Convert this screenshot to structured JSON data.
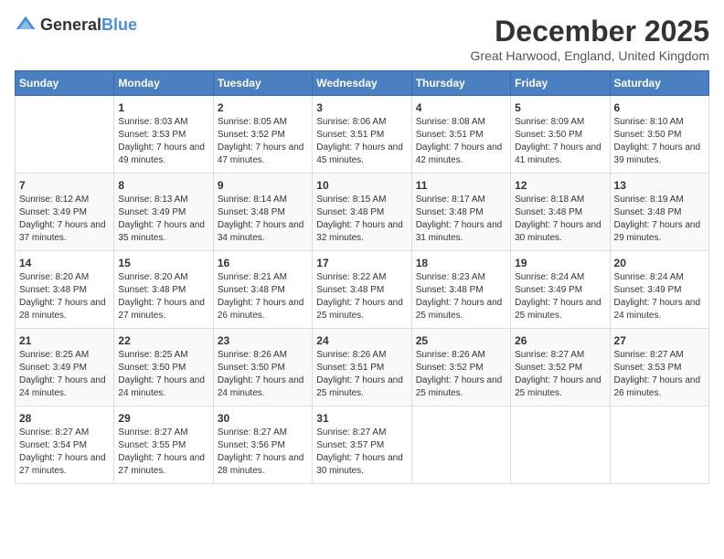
{
  "header": {
    "logo_general": "General",
    "logo_blue": "Blue",
    "month_year": "December 2025",
    "location": "Great Harwood, England, United Kingdom"
  },
  "days_of_week": [
    "Sunday",
    "Monday",
    "Tuesday",
    "Wednesday",
    "Thursday",
    "Friday",
    "Saturday"
  ],
  "weeks": [
    [
      {
        "date": "",
        "sunrise": "",
        "sunset": "",
        "daylight": ""
      },
      {
        "date": "1",
        "sunrise": "Sunrise: 8:03 AM",
        "sunset": "Sunset: 3:53 PM",
        "daylight": "Daylight: 7 hours and 49 minutes."
      },
      {
        "date": "2",
        "sunrise": "Sunrise: 8:05 AM",
        "sunset": "Sunset: 3:52 PM",
        "daylight": "Daylight: 7 hours and 47 minutes."
      },
      {
        "date": "3",
        "sunrise": "Sunrise: 8:06 AM",
        "sunset": "Sunset: 3:51 PM",
        "daylight": "Daylight: 7 hours and 45 minutes."
      },
      {
        "date": "4",
        "sunrise": "Sunrise: 8:08 AM",
        "sunset": "Sunset: 3:51 PM",
        "daylight": "Daylight: 7 hours and 42 minutes."
      },
      {
        "date": "5",
        "sunrise": "Sunrise: 8:09 AM",
        "sunset": "Sunset: 3:50 PM",
        "daylight": "Daylight: 7 hours and 41 minutes."
      },
      {
        "date": "6",
        "sunrise": "Sunrise: 8:10 AM",
        "sunset": "Sunset: 3:50 PM",
        "daylight": "Daylight: 7 hours and 39 minutes."
      }
    ],
    [
      {
        "date": "7",
        "sunrise": "Sunrise: 8:12 AM",
        "sunset": "Sunset: 3:49 PM",
        "daylight": "Daylight: 7 hours and 37 minutes."
      },
      {
        "date": "8",
        "sunrise": "Sunrise: 8:13 AM",
        "sunset": "Sunset: 3:49 PM",
        "daylight": "Daylight: 7 hours and 35 minutes."
      },
      {
        "date": "9",
        "sunrise": "Sunrise: 8:14 AM",
        "sunset": "Sunset: 3:48 PM",
        "daylight": "Daylight: 7 hours and 34 minutes."
      },
      {
        "date": "10",
        "sunrise": "Sunrise: 8:15 AM",
        "sunset": "Sunset: 3:48 PM",
        "daylight": "Daylight: 7 hours and 32 minutes."
      },
      {
        "date": "11",
        "sunrise": "Sunrise: 8:17 AM",
        "sunset": "Sunset: 3:48 PM",
        "daylight": "Daylight: 7 hours and 31 minutes."
      },
      {
        "date": "12",
        "sunrise": "Sunrise: 8:18 AM",
        "sunset": "Sunset: 3:48 PM",
        "daylight": "Daylight: 7 hours and 30 minutes."
      },
      {
        "date": "13",
        "sunrise": "Sunrise: 8:19 AM",
        "sunset": "Sunset: 3:48 PM",
        "daylight": "Daylight: 7 hours and 29 minutes."
      }
    ],
    [
      {
        "date": "14",
        "sunrise": "Sunrise: 8:20 AM",
        "sunset": "Sunset: 3:48 PM",
        "daylight": "Daylight: 7 hours and 28 minutes."
      },
      {
        "date": "15",
        "sunrise": "Sunrise: 8:20 AM",
        "sunset": "Sunset: 3:48 PM",
        "daylight": "Daylight: 7 hours and 27 minutes."
      },
      {
        "date": "16",
        "sunrise": "Sunrise: 8:21 AM",
        "sunset": "Sunset: 3:48 PM",
        "daylight": "Daylight: 7 hours and 26 minutes."
      },
      {
        "date": "17",
        "sunrise": "Sunrise: 8:22 AM",
        "sunset": "Sunset: 3:48 PM",
        "daylight": "Daylight: 7 hours and 25 minutes."
      },
      {
        "date": "18",
        "sunrise": "Sunrise: 8:23 AM",
        "sunset": "Sunset: 3:48 PM",
        "daylight": "Daylight: 7 hours and 25 minutes."
      },
      {
        "date": "19",
        "sunrise": "Sunrise: 8:24 AM",
        "sunset": "Sunset: 3:49 PM",
        "daylight": "Daylight: 7 hours and 25 minutes."
      },
      {
        "date": "20",
        "sunrise": "Sunrise: 8:24 AM",
        "sunset": "Sunset: 3:49 PM",
        "daylight": "Daylight: 7 hours and 24 minutes."
      }
    ],
    [
      {
        "date": "21",
        "sunrise": "Sunrise: 8:25 AM",
        "sunset": "Sunset: 3:49 PM",
        "daylight": "Daylight: 7 hours and 24 minutes."
      },
      {
        "date": "22",
        "sunrise": "Sunrise: 8:25 AM",
        "sunset": "Sunset: 3:50 PM",
        "daylight": "Daylight: 7 hours and 24 minutes."
      },
      {
        "date": "23",
        "sunrise": "Sunrise: 8:26 AM",
        "sunset": "Sunset: 3:50 PM",
        "daylight": "Daylight: 7 hours and 24 minutes."
      },
      {
        "date": "24",
        "sunrise": "Sunrise: 8:26 AM",
        "sunset": "Sunset: 3:51 PM",
        "daylight": "Daylight: 7 hours and 25 minutes."
      },
      {
        "date": "25",
        "sunrise": "Sunrise: 8:26 AM",
        "sunset": "Sunset: 3:52 PM",
        "daylight": "Daylight: 7 hours and 25 minutes."
      },
      {
        "date": "26",
        "sunrise": "Sunrise: 8:27 AM",
        "sunset": "Sunset: 3:52 PM",
        "daylight": "Daylight: 7 hours and 25 minutes."
      },
      {
        "date": "27",
        "sunrise": "Sunrise: 8:27 AM",
        "sunset": "Sunset: 3:53 PM",
        "daylight": "Daylight: 7 hours and 26 minutes."
      }
    ],
    [
      {
        "date": "28",
        "sunrise": "Sunrise: 8:27 AM",
        "sunset": "Sunset: 3:54 PM",
        "daylight": "Daylight: 7 hours and 27 minutes."
      },
      {
        "date": "29",
        "sunrise": "Sunrise: 8:27 AM",
        "sunset": "Sunset: 3:55 PM",
        "daylight": "Daylight: 7 hours and 27 minutes."
      },
      {
        "date": "30",
        "sunrise": "Sunrise: 8:27 AM",
        "sunset": "Sunset: 3:56 PM",
        "daylight": "Daylight: 7 hours and 28 minutes."
      },
      {
        "date": "31",
        "sunrise": "Sunrise: 8:27 AM",
        "sunset": "Sunset: 3:57 PM",
        "daylight": "Daylight: 7 hours and 30 minutes."
      },
      {
        "date": "",
        "sunrise": "",
        "sunset": "",
        "daylight": ""
      },
      {
        "date": "",
        "sunrise": "",
        "sunset": "",
        "daylight": ""
      },
      {
        "date": "",
        "sunrise": "",
        "sunset": "",
        "daylight": ""
      }
    ]
  ]
}
